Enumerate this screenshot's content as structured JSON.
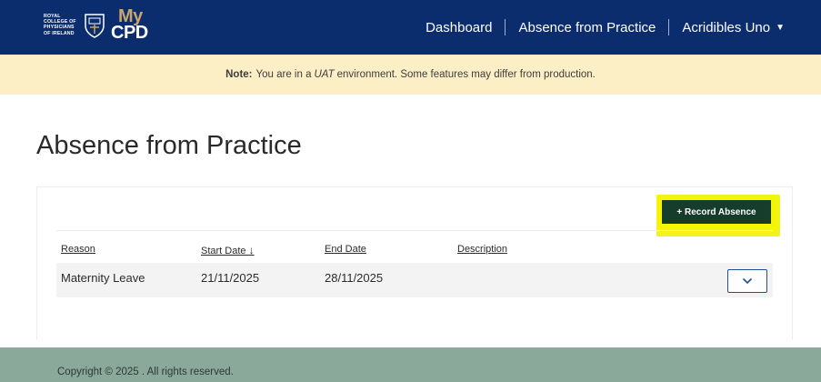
{
  "header": {
    "logo_small_text": "ROYAL COLLEGE OF PHYSICIANS OF IRELAND",
    "logo_my": "My",
    "logo_cpd": "CPD",
    "nav": {
      "dashboard": "Dashboard",
      "absence": "Absence from Practice",
      "user": "Acridibles Uno",
      "user_caret_icon": "caret-down-icon"
    }
  },
  "notice": {
    "label": "Note:",
    "text_before": "You are in a",
    "env": "UAT",
    "text_after": "environment. Some features may differ from production."
  },
  "page": {
    "title": "Absence from Practice",
    "record_button": "+ Record Absence"
  },
  "table": {
    "headers": {
      "reason": "Reason",
      "start_date": "Start Date",
      "start_sort_icon": "arrow-down-icon",
      "end_date": "End Date",
      "description": "Description"
    },
    "rows": [
      {
        "reason": "Maternity Leave",
        "start_date": "21/11/2025",
        "end_date": "28/11/2025",
        "description": "",
        "expand_icon": "chevron-down-icon"
      }
    ]
  },
  "footer": {
    "copyright": "Copyright © 2025 . All rights reserved."
  },
  "colors": {
    "header_bg": "#0b2d6e",
    "notice_bg": "#fcefc6",
    "button_bg": "#163d2b",
    "highlight": "#f2f21c",
    "footer_bg": "#8aa99b"
  }
}
